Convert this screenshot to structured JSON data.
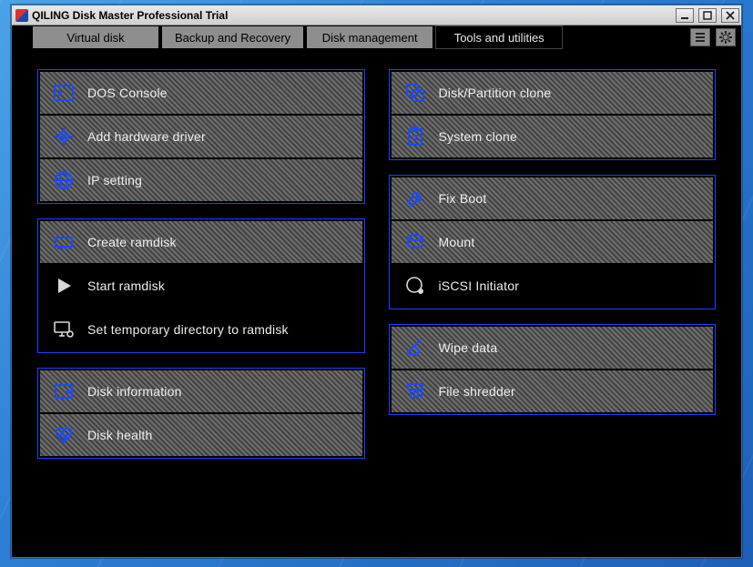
{
  "window": {
    "title": "QILING Disk Master Professional Trial"
  },
  "tabs": {
    "virtual_disk": "Virtual disk",
    "backup_recovery": "Backup and Recovery",
    "disk_management": "Disk management",
    "tools_utilities": "Tools and utilities"
  },
  "left": {
    "g1": {
      "dos_console": "DOS Console",
      "add_driver": "Add hardware driver",
      "ip_setting": "IP setting"
    },
    "g2": {
      "create_ramdisk": "Create ramdisk",
      "start_ramdisk": "Start ramdisk",
      "set_temp_dir": "Set temporary directory to ramdisk"
    },
    "g3": {
      "disk_info": "Disk information",
      "disk_health": "Disk health"
    }
  },
  "right": {
    "g1": {
      "partition_clone": "Disk/Partition clone",
      "system_clone": "System clone"
    },
    "g2": {
      "fix_boot": "Fix Boot",
      "mount": "Mount",
      "iscsi": "iSCSI Initiator"
    },
    "g3": {
      "wipe_data": "Wipe data",
      "file_shredder": "File shredder"
    }
  }
}
